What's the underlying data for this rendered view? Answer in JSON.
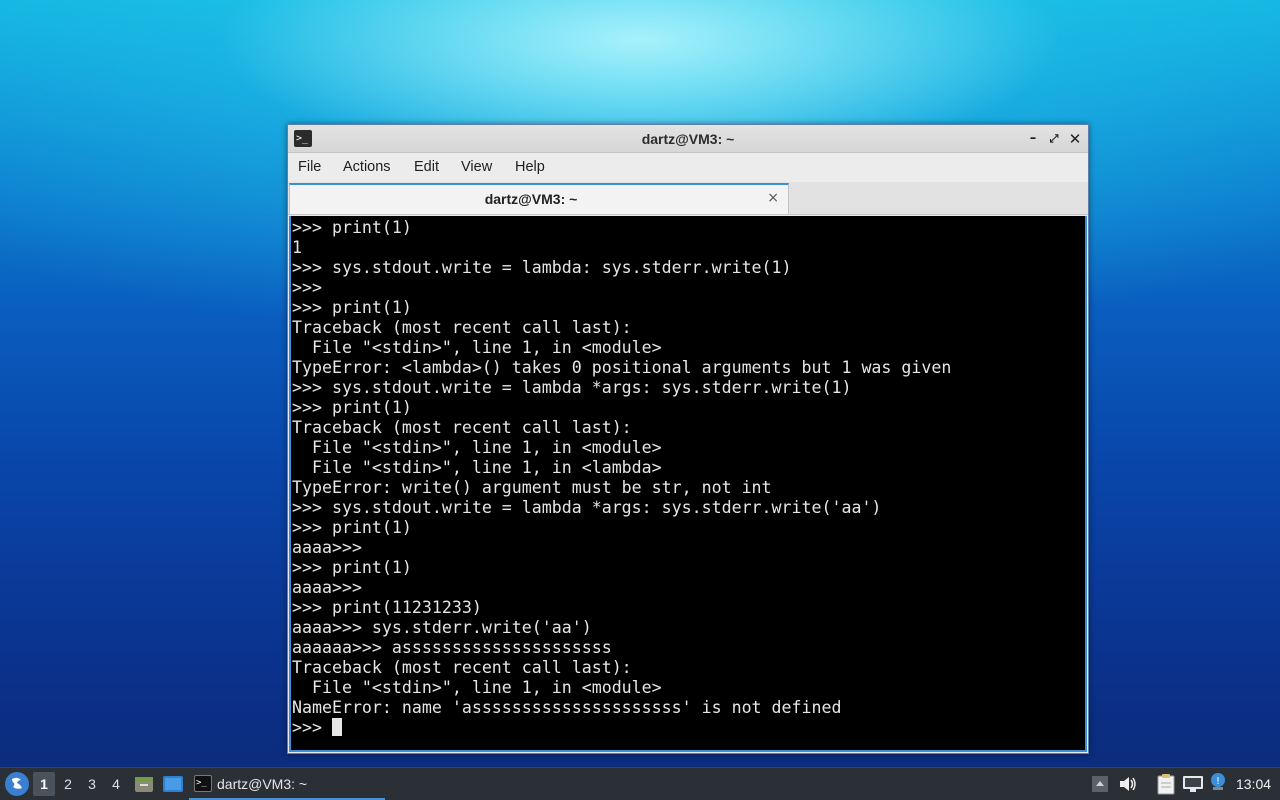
{
  "window": {
    "title": "dartz@VM3: ~",
    "app_icon": ">_",
    "minimize": "–",
    "maximize": "⤢",
    "close": "✕"
  },
  "menubar": {
    "items": [
      "File",
      "Actions",
      "Edit",
      "View",
      "Help"
    ]
  },
  "tab": {
    "label": "dartz@VM3: ~",
    "close": "×"
  },
  "terminal": {
    "lines": [
      ">>> print(1)",
      "1",
      ">>> sys.stdout.write = lambda: sys.stderr.write(1)",
      ">>>",
      ">>> print(1)",
      "Traceback (most recent call last):",
      "  File \"<stdin>\", line 1, in <module>",
      "TypeError: <lambda>() takes 0 positional arguments but 1 was given",
      ">>> sys.stdout.write = lambda *args: sys.stderr.write(1)",
      ">>> print(1)",
      "Traceback (most recent call last):",
      "  File \"<stdin>\", line 1, in <module>",
      "  File \"<stdin>\", line 1, in <lambda>",
      "TypeError: write() argument must be str, not int",
      ">>> sys.stdout.write = lambda *args: sys.stderr.write('aa')",
      ">>> print(1)",
      "aaaa>>>",
      ">>> print(1)",
      "aaaa>>>",
      ">>> print(11231233)",
      "aaaa>>> sys.stderr.write('aa')",
      "aaaaaa>>> asssssssssssssssssssss",
      "Traceback (most recent call last):",
      "  File \"<stdin>\", line 1, in <module>",
      "NameError: name 'asssssssssssssssssssss' is not defined"
    ],
    "prompt": ">>> "
  },
  "taskbar": {
    "start_icon": "start-menu-icon",
    "workspaces": [
      "1",
      "2",
      "3",
      "4"
    ],
    "active_workspace": "1",
    "task_label": "dartz@VM3: ~",
    "clock": "13:04"
  },
  "colors": {
    "accent": "#3a8fd8",
    "terminal_bg": "#000000",
    "terminal_fg": "#e6e6e6",
    "taskbar_bg": "#2b3036"
  }
}
